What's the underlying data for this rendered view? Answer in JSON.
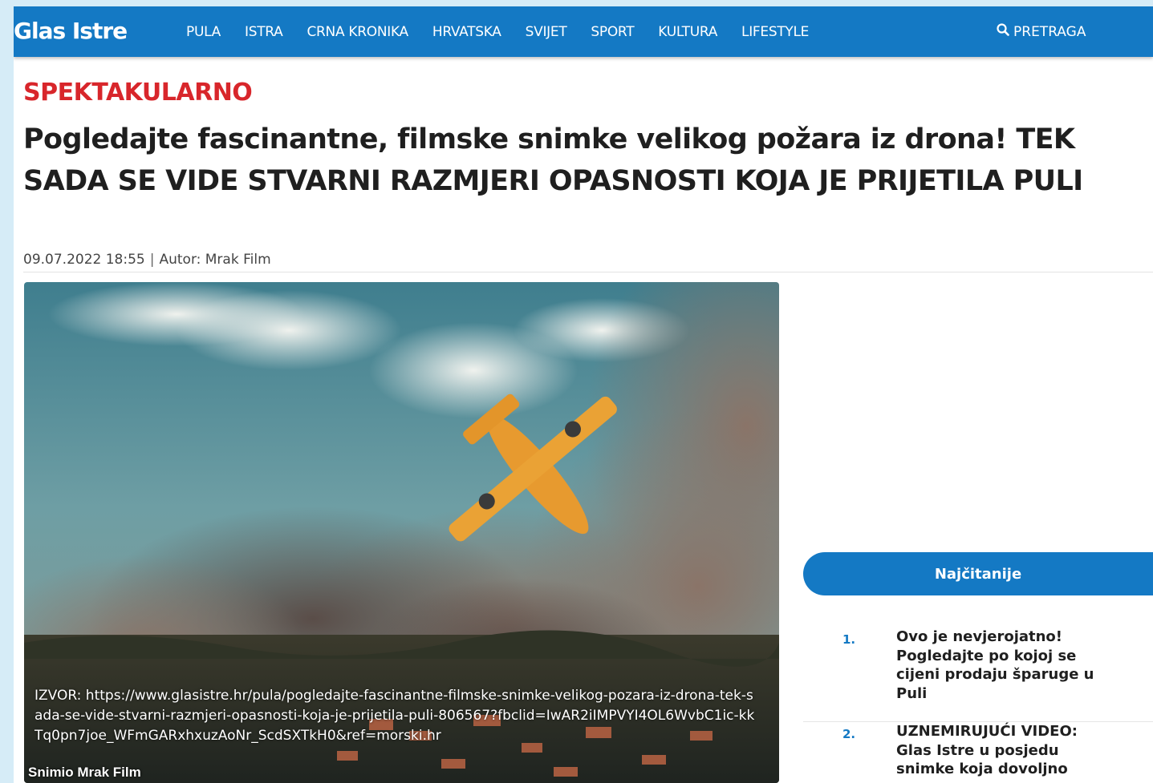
{
  "header": {
    "logo": "Glas Istre",
    "nav": [
      "PULA",
      "ISTRA",
      "CRNA KRONIKA",
      "HRVATSKA",
      "SVIJET",
      "SPORT",
      "KULTURA",
      "LIFESTYLE"
    ],
    "search_label": "PRETRAGA"
  },
  "article": {
    "kicker": "SPEKTAKULARNO",
    "headline": "Pogledajte fascinantne, filmske snimke velikog požara iz drona! TEK SADA SE VIDE STVARNI RAZMJERI OPASNOSTI KOJA JE PRIJETILA PULI",
    "date": "09.07.2022 18:55",
    "separator": "|",
    "author": "Autor: Mrak Film",
    "source_text": "IZVOR: https://www.glasistre.hr/pula/pogledajte-fascinantne-filmske-snimke-velikog-pozara-iz-drona-tek-sada-se-vide-stvarni-razmjeri-opasnosti-koja-je-prijetila-puli-806567?fbclid=IwAR2iIMPVYI4OL6WvbC1ic-kkTq0pn7joe_WFmGARxhxuzAoNr_ScdSXTkH0&ref=morski.hr",
    "photo_credit": "Snimio Mrak Film"
  },
  "sidebar": {
    "popular_title": "Najčitanije",
    "items": [
      {
        "num": "1.",
        "title": "Ovo je nevjerojatno! Pogledajte po kojoj se cijeni prodaju šparuge u Puli"
      },
      {
        "num": "2.",
        "title": "UZNEMIRUJUĆI VIDEO: Glas Istre u posjedu snimke koja dovoljno"
      }
    ]
  },
  "colors": {
    "brand_blue": "#1479c4",
    "kicker_red": "#d8262b"
  },
  "icons": {
    "search": "search-icon"
  }
}
